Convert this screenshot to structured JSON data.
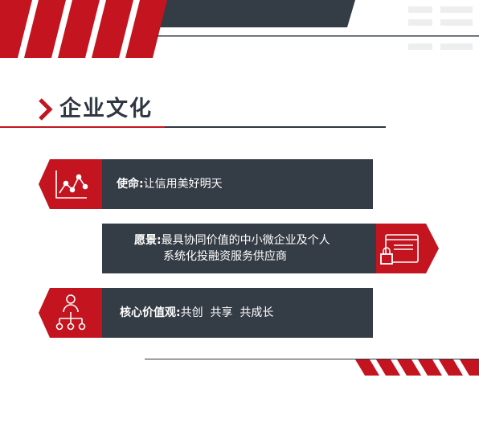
{
  "section": {
    "title": "企业文化"
  },
  "cards": [
    {
      "label": "使命",
      "separator": ":",
      "text": "让信用美好明天",
      "icon": "line-chart-icon"
    },
    {
      "label": "愿景",
      "separator": ":",
      "text": "最具协同价值的中小微企业及个人",
      "text2": "系统化投融资服务供应商",
      "icon": "browser-lock-icon"
    },
    {
      "label": "核心价值观",
      "separator": ":",
      "text": "共创  共享  共成长",
      "icon": "org-network-icon"
    }
  ],
  "colors": {
    "accent": "#c3141f",
    "dark": "#343c45",
    "background": "#ffffff"
  }
}
